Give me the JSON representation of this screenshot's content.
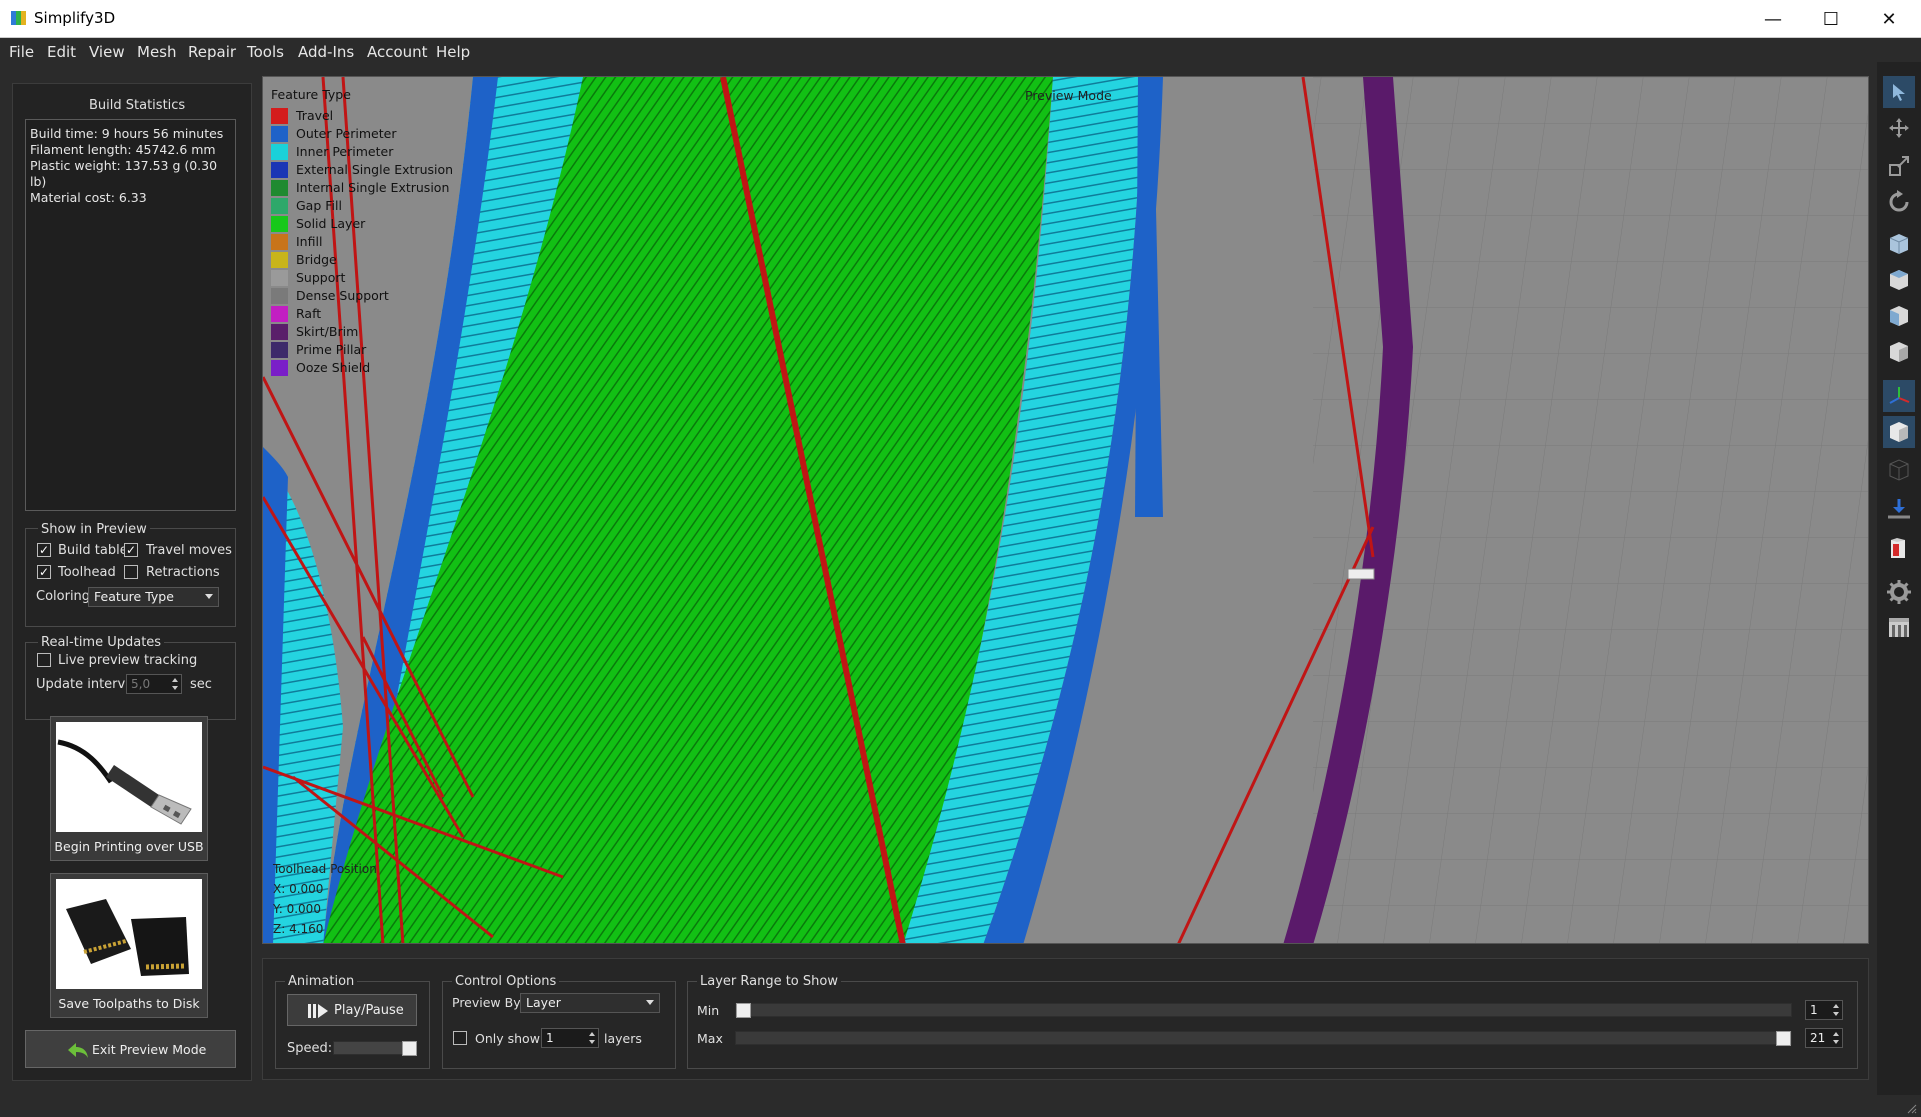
{
  "window": {
    "title": "Simplify3D",
    "minimize_glyph": "—",
    "maximize_glyph": "☐",
    "close_glyph": "✕"
  },
  "menu": [
    "File",
    "Edit",
    "View",
    "Mesh",
    "Repair",
    "Tools",
    "Add-Ins",
    "Account",
    "Help"
  ],
  "build_statistics": {
    "title": "Build Statistics",
    "lines": [
      "Build time: 9 hours 56 minutes",
      "Filament length: 45742.6 mm",
      "Plastic weight: 137.53 g (0.30 lb)",
      "Material cost: 6.33"
    ]
  },
  "show_in_preview": {
    "title": "Show in Preview",
    "build_table": {
      "label": "Build table",
      "checked": true
    },
    "travel_moves": {
      "label": "Travel moves",
      "checked": true
    },
    "toolhead": {
      "label": "Toolhead",
      "checked": true
    },
    "retractions": {
      "label": "Retractions",
      "checked": false
    },
    "coloring_label": "Coloring",
    "coloring_value": "Feature Type"
  },
  "realtime": {
    "title": "Real-time Updates",
    "live_label": "Live preview tracking",
    "live_checked": false,
    "interval_label": "Update interval",
    "interval_value": "5,0",
    "interval_unit": "sec"
  },
  "buttons": {
    "usb_label": "Begin Printing over USB",
    "disk_label": "Save Toolpaths to Disk",
    "exit_label": "Exit Preview Mode"
  },
  "viewport": {
    "legend_title": "Feature Type",
    "mode_label": "Preview Mode",
    "legend": [
      {
        "name": "Travel",
        "color": "#d41c1c"
      },
      {
        "name": "Outer Perimeter",
        "color": "#1e62c8"
      },
      {
        "name": "Inner Perimeter",
        "color": "#1ad1d9"
      },
      {
        "name": "External Single Extrusion",
        "color": "#1a35b5"
      },
      {
        "name": "Internal Single Extrusion",
        "color": "#1f8a30"
      },
      {
        "name": "Gap Fill",
        "color": "#2ea86a"
      },
      {
        "name": "Solid Layer",
        "color": "#17c81a"
      },
      {
        "name": "Infill",
        "color": "#c8741a"
      },
      {
        "name": "Bridge",
        "color": "#c8b41a"
      },
      {
        "name": "Support",
        "color": "#9a9a9a"
      },
      {
        "name": "Dense Support",
        "color": "#7a7a7a"
      },
      {
        "name": "Raft",
        "color": "#c21ec2"
      },
      {
        "name": "Skirt/Brim",
        "color": "#5a1f6a"
      },
      {
        "name": "Prime Pillar",
        "color": "#3d2a6a"
      },
      {
        "name": "Ooze Shield",
        "color": "#7a1ec8"
      }
    ],
    "toolhead_title": "Toolhead Position",
    "x_line": "X: 0.000",
    "y_line": "Y: 0.000",
    "z_line": "Z: 4.160"
  },
  "animation": {
    "title": "Animation",
    "play_label": "Play/Pause",
    "speed_label": "Speed:"
  },
  "control_options": {
    "title": "Control Options",
    "preview_by_label": "Preview By",
    "preview_by_value": "Layer",
    "only_show_label": "Only show",
    "only_show_value": "1",
    "layers_label": "layers"
  },
  "layer_range": {
    "title": "Layer Range to Show",
    "min_label": "Min",
    "min_value": "1",
    "max_label": "Max",
    "max_value": "21"
  }
}
